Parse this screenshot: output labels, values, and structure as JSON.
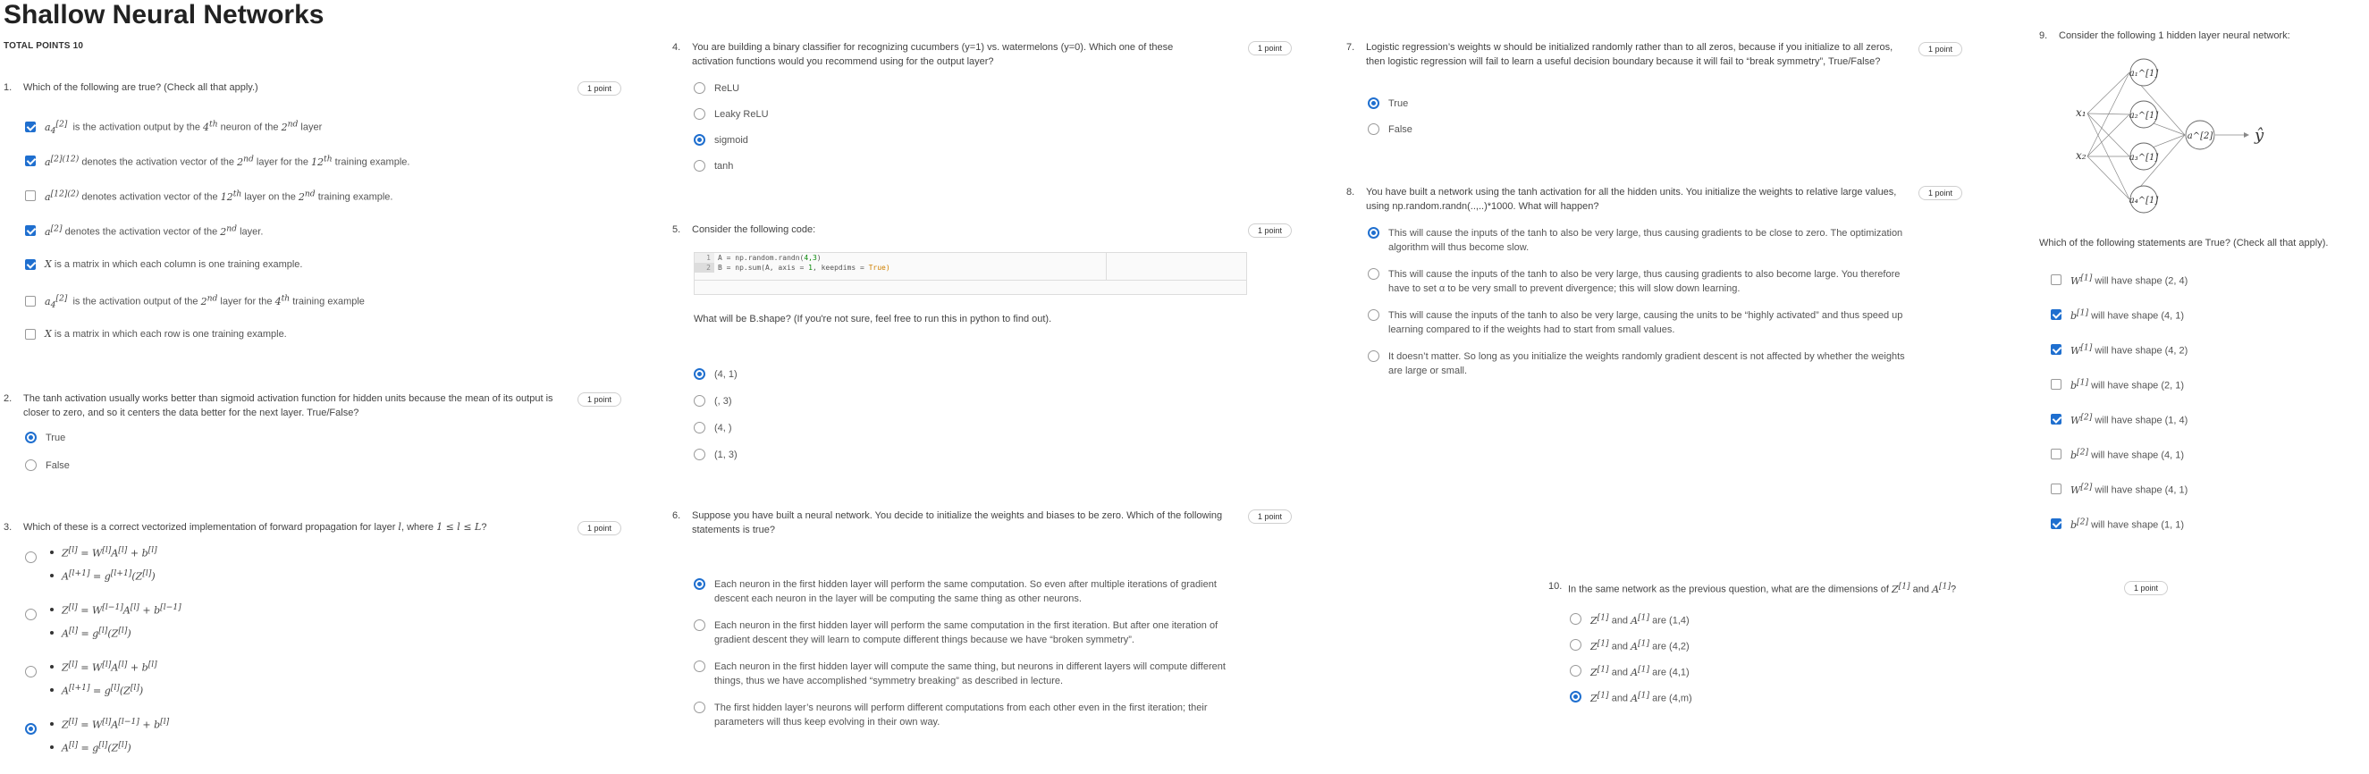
{
  "header": {
    "title": "Shallow Neural Networks",
    "total_points": "TOTAL POINTS 10"
  },
  "questions": [
    {
      "num": "1.",
      "text": "Which of the following are true? (Check all that apply.)",
      "points": "1 point",
      "options": [
        {
          "text": "a₄^[2] is the activation output by the 4th neuron of the 2nd layer",
          "checked": true
        },
        {
          "text": "a^[2](12) denotes the activation vector of the 2nd layer for the 12th training example.",
          "checked": true
        },
        {
          "text": "a^[12](2) denotes activation vector of the 12th layer on the 2nd training example.",
          "checked": false
        },
        {
          "text": "a^[2] denotes the activation vector of the 2nd layer.",
          "checked": true
        },
        {
          "text": "X is a matrix in which each column is one training example.",
          "checked": true
        },
        {
          "text": "a₄^[2] is the activation output of the 2nd layer for the 4th training example",
          "checked": false
        },
        {
          "text": "X is a matrix in which each row is one training example.",
          "checked": false
        }
      ]
    },
    {
      "num": "2.",
      "text": "The tanh activation usually works better than sigmoid activation function for hidden units because the mean of its output is closer to zero, and so it centers the data better for the next layer. True/False?",
      "points": "1 point",
      "options": [
        {
          "text": "True",
          "checked": true
        },
        {
          "text": "False",
          "checked": false
        }
      ]
    },
    {
      "num": "3.",
      "text": "Which of these is a correct vectorized implementation of forward propagation for layer l, where 1 ≤ l ≤ L?",
      "points": "1 point",
      "options": [
        {
          "line1": "Z^[l] = W^[l] A^[l] + b^[l]",
          "line2": "A^[l+1] = g^[l+1](Z^[l])",
          "checked": false
        },
        {
          "line1": "Z^[l] = W^[l-1] A^[l] + b^[l-1]",
          "line2": "A^[l] = g^[l](Z^[l])",
          "checked": false
        },
        {
          "line1": "Z^[l] = W^[l] A^[l] + b^[l]",
          "line2": "A^[l+1] = g^[l](Z^[l])",
          "checked": false
        },
        {
          "line1": "Z^[l] = W^[l] A^[l-1] + b^[l]",
          "line2": "A^[l] = g^[l](Z^[l])",
          "checked": true
        }
      ]
    },
    {
      "num": "4.",
      "text": "You are building a binary classifier for recognizing cucumbers (y=1) vs. watermelons (y=0). Which one of these activation functions would you recommend using for the output layer?",
      "points": "1 point",
      "options": [
        {
          "text": "ReLU",
          "checked": false
        },
        {
          "text": "Leaky ReLU",
          "checked": false
        },
        {
          "text": "sigmoid",
          "checked": true
        },
        {
          "text": "tanh",
          "checked": false
        }
      ]
    },
    {
      "num": "5.",
      "text": "Consider the following code:",
      "points": "1 point",
      "code": [
        {
          "n": "1",
          "pre": "A = np.random.randn(",
          "arg": "4,3",
          "post": ")",
          "kw": ""
        },
        {
          "n": "2",
          "pre": "B = np.sum(A, axis = ",
          "arg": "1",
          "post": ", keepdims = ",
          "kw": "True)"
        }
      ],
      "followup": "What will be B.shape? (If you're not sure, feel free to run this in python to find out).",
      "options": [
        {
          "text": "(4, 1)",
          "checked": true
        },
        {
          "text": "(, 3)",
          "checked": false
        },
        {
          "text": "(4, )",
          "checked": false
        },
        {
          "text": "(1, 3)",
          "checked": false
        }
      ]
    },
    {
      "num": "6.",
      "text": "Suppose you have built a neural network. You decide to initialize the weights and biases to be zero. Which of the following statements is true?",
      "points": "1 point",
      "options": [
        {
          "text": "Each neuron in the first hidden layer will perform the same computation. So even after multiple iterations of gradient descent each neuron in the layer will be computing the same thing as other neurons.",
          "checked": true
        },
        {
          "text": "Each neuron in the first hidden layer will perform the same computation in the first iteration. But after one iteration of gradient descent they will learn to compute different things because we have “broken symmetry”.",
          "checked": false
        },
        {
          "text": "Each neuron in the first hidden layer will compute the same thing, but neurons in different layers will compute different things, thus we have accomplished “symmetry breaking” as described in lecture.",
          "checked": false
        },
        {
          "text": "The first hidden layer’s neurons will perform different computations from each other even in the first iteration; their parameters will thus keep evolving in their own way.",
          "checked": false
        }
      ]
    },
    {
      "num": "7.",
      "text": "Logistic regression’s weights w should be initialized randomly rather than to all zeros, because if you initialize to all zeros, then logistic regression will fail to learn a useful decision boundary because it will fail to “break symmetry”, True/False?",
      "points": "1 point",
      "options": [
        {
          "text": "True",
          "checked": true
        },
        {
          "text": "False",
          "checked": false
        }
      ]
    },
    {
      "num": "8.",
      "text": "You have built a network using the tanh activation for all the hidden units. You initialize the weights to relative large values, using np.random.randn(..,..)*1000. What will happen?",
      "points": "1 point",
      "options": [
        {
          "text": "This will cause the inputs of the tanh to also be very large, thus causing gradients to be close to zero. The optimization algorithm will thus become slow.",
          "checked": true
        },
        {
          "text": "This will cause the inputs of the tanh to also be very large, thus causing gradients to also become large. You therefore have to set α to be very small to prevent divergence; this will slow down learning.",
          "checked": false
        },
        {
          "text": "This will cause the inputs of the tanh to also be very large, causing the units to be “highly activated” and thus speed up learning compared to if the weights had to start from small values.",
          "checked": false
        },
        {
          "text": "It doesn’t matter. So long as you initialize the weights randomly gradient descent is not affected by whether the weights are large or small.",
          "checked": false
        }
      ]
    },
    {
      "num": "9.",
      "text": "Consider the following 1 hidden layer neural network:",
      "points": "",
      "diagram": {
        "inputs": [
          "x₁",
          "x₂"
        ],
        "hidden": [
          "a₁^[1]",
          "a₂^[1]",
          "a₃^[1]",
          "a₄^[1]"
        ],
        "output": "a^[2]",
        "yhat": "ŷ"
      },
      "followup": "Which of the following statements are True? (Check all that apply).",
      "options": [
        {
          "text": "W^[1] will have shape (2, 4)",
          "checked": false
        },
        {
          "text": "b^[1] will have shape (4, 1)",
          "checked": true
        },
        {
          "text": "W^[1] will have shape (4, 2)",
          "checked": true
        },
        {
          "text": "b^[1] will have shape (2, 1)",
          "checked": false
        },
        {
          "text": "W^[2] will have shape (1, 4)",
          "checked": true
        },
        {
          "text": "b^[2] will have shape (4, 1)",
          "checked": false
        },
        {
          "text": "W^[2] will have shape (4, 1)",
          "checked": false
        },
        {
          "text": "b^[2] will have shape (1, 1)",
          "checked": true
        }
      ]
    },
    {
      "num": "10.",
      "text": "In the same network as the previous question, what are the dimensions of Z^[1] and A^[1]?",
      "points": "1 point",
      "options": [
        {
          "text": "Z^[1] and A^[1] are (1,4)",
          "checked": false
        },
        {
          "text": "Z^[1] and A^[1] are (4,2)",
          "checked": false
        },
        {
          "text": "Z^[1] and A^[1] are (4,1)",
          "checked": false
        },
        {
          "text": "Z^[1] and A^[1] are (4,m)",
          "checked": true
        }
      ]
    }
  ],
  "colors": {
    "accent": "#1f6fcf"
  }
}
